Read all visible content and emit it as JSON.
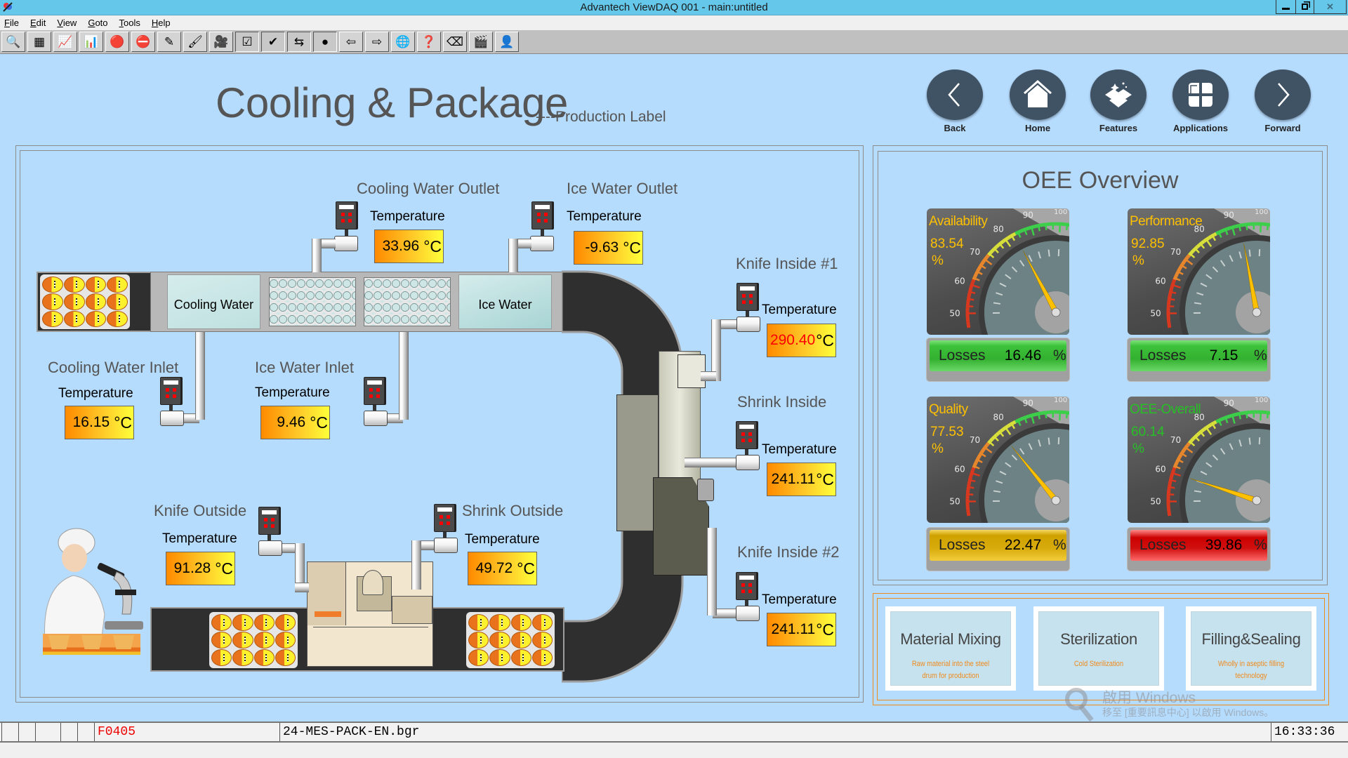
{
  "window": {
    "title": "Advantech ViewDAQ 001 - main:untitled",
    "controls": {
      "minimize": "minimize-icon",
      "restore": "restore-icon",
      "close": "close-icon"
    }
  },
  "menu": [
    {
      "label": "File",
      "accel": "F"
    },
    {
      "label": "Edit",
      "accel": "E"
    },
    {
      "label": "View",
      "accel": "V"
    },
    {
      "label": "Goto",
      "accel": "G"
    },
    {
      "label": "Tools",
      "accel": "T"
    },
    {
      "label": "Help",
      "accel": "H"
    }
  ],
  "toolbar": [
    {
      "icon": "magnifier-icon",
      "glyph": "🔍"
    },
    {
      "icon": "database-rack-icon",
      "glyph": "▦"
    },
    {
      "icon": "trend-report-icon",
      "glyph": "📈"
    },
    {
      "icon": "chart-report-icon",
      "glyph": "📊"
    },
    {
      "icon": "alarm-bell-icon",
      "glyph": "🔴"
    },
    {
      "icon": "alarm-bells-multiple-icon",
      "glyph": "⛔"
    },
    {
      "icon": "edit-tool-icon",
      "glyph": "✎"
    },
    {
      "icon": "paint-icon",
      "glyph": "🖌"
    },
    {
      "icon": "video-camera-icon",
      "glyph": "🎥"
    },
    {
      "icon": "check-box-icon",
      "glyph": "☑",
      "pressed": true
    },
    {
      "icon": "check-apple-icon",
      "glyph": "✔",
      "pressed": true
    },
    {
      "icon": "page-swap-icon",
      "glyph": "⇆",
      "pressed": true
    },
    {
      "icon": "color-balls-icon",
      "glyph": "●",
      "pressed": true
    },
    {
      "icon": "arrow-left-icon",
      "glyph": "⇦"
    },
    {
      "icon": "arrow-right-icon",
      "glyph": "⇨"
    },
    {
      "icon": "globe-network-icon",
      "glyph": "🌐"
    },
    {
      "icon": "help-book-icon",
      "glyph": "❓"
    },
    {
      "icon": "eraser-icon",
      "glyph": "⌫"
    },
    {
      "icon": "clapper-board-icon",
      "glyph": "🎬"
    },
    {
      "icon": "user-icon",
      "glyph": "👤"
    }
  ],
  "header": {
    "title": "Cooling & Package",
    "subtitle": "----Production Label"
  },
  "nav": [
    {
      "label": "Back",
      "icon": "chevron-left-icon"
    },
    {
      "label": "Home",
      "icon": "home-icon"
    },
    {
      "label": "Features",
      "icon": "features-box-icon"
    },
    {
      "label": "Applications",
      "icon": "apps-grid-icon"
    },
    {
      "label": "Forward",
      "icon": "chevron-right-icon"
    }
  ],
  "process": {
    "temperature_label": "Temperature",
    "unit": "°C",
    "tanks": {
      "cooling": "Cooling Water",
      "ice": "Ice Water"
    },
    "sensors": {
      "cooling_water_outlet": {
        "name": "Cooling Water Outlet",
        "value": "33.96"
      },
      "ice_water_outlet": {
        "name": "Ice Water Outlet",
        "value": "-9.63"
      },
      "cooling_water_inlet": {
        "name": "Cooling Water Inlet",
        "value": "16.15"
      },
      "ice_water_inlet": {
        "name": "Ice Water Inlet",
        "value": "9.46"
      },
      "knife_inside_1": {
        "name": "Knife Inside #1",
        "value": "290.40",
        "alarm": true
      },
      "shrink_inside": {
        "name": "Shrink Inside",
        "value": "241.11"
      },
      "knife_inside_2": {
        "name": "Knife Inside #2",
        "value": "241.11"
      },
      "knife_outside": {
        "name": "Knife Outside",
        "value": "91.28"
      },
      "shrink_outside": {
        "name": "Shrink Outside",
        "value": "49.72"
      }
    }
  },
  "oee": {
    "title": "OEE Overview",
    "losses_label": "Losses",
    "percent": "%",
    "scale_ticks": [
      "50",
      "60",
      "70",
      "80",
      "90",
      "100"
    ],
    "gauges": [
      {
        "name": "Availability",
        "value": "83.54",
        "value_num": 83.54,
        "losses": "16.46",
        "loss_status": "green",
        "title_color": "#ffc000"
      },
      {
        "name": "Performance",
        "value": "92.85",
        "value_num": 92.85,
        "losses": "7.15",
        "loss_status": "green",
        "title_color": "#ffc000"
      },
      {
        "name": "Quality",
        "value": "77.53",
        "value_num": 77.53,
        "losses": "22.47",
        "loss_status": "yellow",
        "title_color": "#ffc000"
      },
      {
        "name": "OEE-Overall",
        "value": "60.14",
        "value_num": 60.14,
        "losses": "39.86",
        "loss_status": "red",
        "title_color": "#26c026"
      }
    ]
  },
  "process_steps": [
    {
      "title": "Material Mixing",
      "desc": "Raw material into the steel drum for production"
    },
    {
      "title": "Sterilization",
      "desc": "Cold Sterilization"
    },
    {
      "title": "Filling&Sealing",
      "desc": "Wholly in aseptic filling technology"
    }
  ],
  "watermark": {
    "line1": "啟用 Windows",
    "line2": "移至 [重要訊息中心] 以啟用 Windows。"
  },
  "statusbar": {
    "code": "F0405",
    "file": "24-MES-PACK-EN.bgr",
    "time": "16:33:36"
  },
  "colors": {
    "background": "#b5dbfd",
    "titlebar": "#65c8eb",
    "accent_orange": "#f08a1c",
    "alarm": "#ff0000",
    "gauge_label": "#ffc000",
    "gauge_label_green": "#26c026"
  }
}
